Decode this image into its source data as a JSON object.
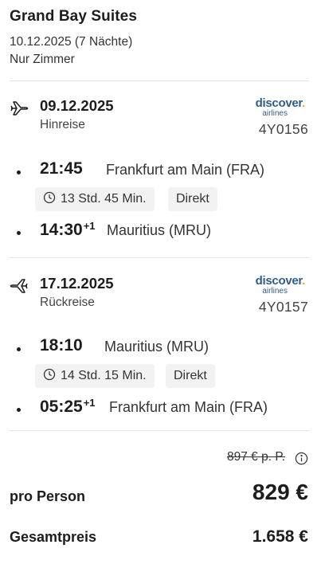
{
  "hotel": {
    "name": "Grand Bay Suites",
    "dates": "10.12.2025 (7 Nächte)",
    "board": "Nur Zimmer"
  },
  "outbound": {
    "date": "09.12.2025",
    "direction": "Hinreise",
    "airline_logo": "discover",
    "airline_logo_sub": "airlines",
    "flight_number": "4Y0156",
    "departure_time": "21:45",
    "departure_place": "Frankfurt am Main (FRA)",
    "duration": "13 Std. 45 Min.",
    "stops": "Direkt",
    "arrival_time": "14:30",
    "arrival_day_offset": "+1",
    "arrival_place": "Mauritius (MRU)",
    "icon": "plane-departure-icon"
  },
  "return": {
    "date": "17.12.2025",
    "direction": "Rückreise",
    "airline_logo": "discover",
    "airline_logo_sub": "airlines",
    "flight_number": "4Y0157",
    "departure_time": "18:10",
    "departure_place": "Mauritius (MRU)",
    "duration": "14 Std. 15 Min.",
    "stops": "Direkt",
    "arrival_time": "05:25",
    "arrival_day_offset": "+1",
    "arrival_place": "Frankfurt am Main (FRA)",
    "icon": "plane-return-icon"
  },
  "pricing": {
    "old_price": "897 € p. P.",
    "per_person_label": "pro Person",
    "per_person_price": "829 €",
    "total_label": "Gesamtpreis",
    "total_price": "1.658 €"
  },
  "colors": {
    "airline_brand": "#2f5d8a",
    "airline_dot": "#f5a623",
    "chip_bg": "#f2f2f2",
    "divider": "#e3e3e3"
  }
}
